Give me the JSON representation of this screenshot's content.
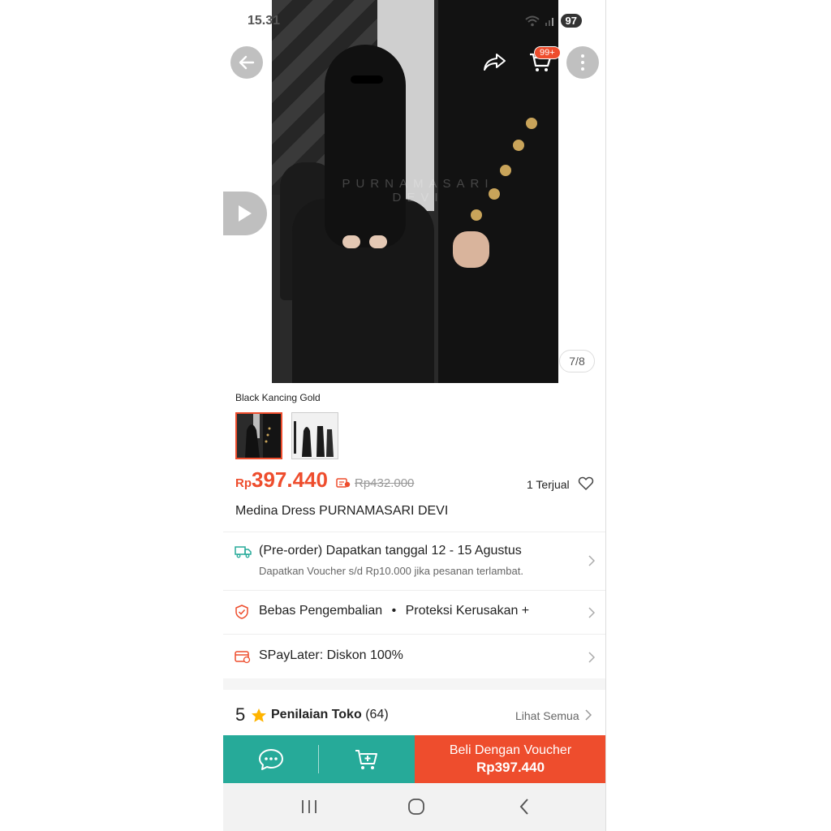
{
  "status_bar": {
    "time": "15.31",
    "battery": "97"
  },
  "header": {
    "cart_badge": "99+"
  },
  "gallery": {
    "counter": "7/8",
    "watermark": "PURNAMASARI DEVI"
  },
  "variant": {
    "selected_label": "Black Kancing Gold"
  },
  "pricing": {
    "currency": "Rp",
    "price": "397.440",
    "original_price": "Rp432.000",
    "sold": "1 Terjual"
  },
  "product": {
    "title": "Medina Dress PURNAMASARI DEVI"
  },
  "shipping": {
    "title": "(Pre-order) Dapatkan tanggal 12 - 15 Agustus",
    "subtitle": "Dapatkan Voucher s/d Rp10.000 jika pesanan terlambat."
  },
  "guarantee": {
    "part1": "Bebas Pengembalian",
    "separator": "•",
    "part2": "Proteksi Kerusakan +"
  },
  "paylater": {
    "label": "SPayLater: Diskon 100%"
  },
  "rating": {
    "score": "5",
    "title": "Penilaian Toko",
    "count": "(64)",
    "see_all": "Lihat Semua"
  },
  "action_bar": {
    "buy_line1": "Beli Dengan Voucher",
    "buy_line2": "Rp397.440"
  },
  "colors": {
    "accent": "#ee4d2d",
    "teal": "#26aa99",
    "star": "#ffb400"
  },
  "icons": [
    "back-arrow-icon",
    "share-icon",
    "cart-icon",
    "more-icon",
    "play-icon",
    "truck-icon",
    "shield-icon",
    "paylater-icon",
    "chevron-right-icon",
    "heart-icon",
    "star-icon",
    "chat-icon",
    "add-to-cart-icon",
    "recent-apps-icon",
    "home-icon",
    "back-icon"
  ]
}
